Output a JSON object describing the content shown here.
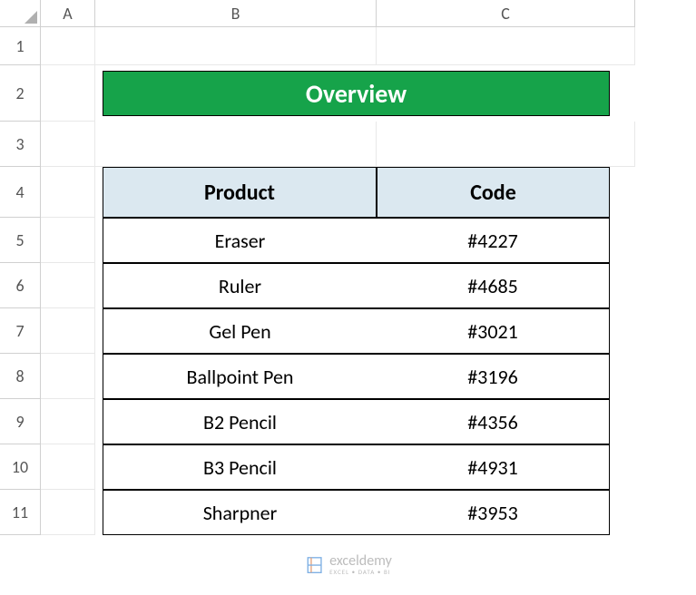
{
  "columns": [
    "A",
    "B",
    "C"
  ],
  "rows": [
    "1",
    "2",
    "3",
    "4",
    "5",
    "6",
    "7",
    "8",
    "9",
    "10",
    "11"
  ],
  "title": "Overview",
  "table": {
    "headers": {
      "product": "Product",
      "code": "Code"
    },
    "data": [
      {
        "product": "Eraser",
        "code": "#4227"
      },
      {
        "product": "Ruler",
        "code": "#4685"
      },
      {
        "product": "Gel Pen",
        "code": "#3021"
      },
      {
        "product": "Ballpoint Pen",
        "code": "#3196"
      },
      {
        "product": "B2 Pencil",
        "code": "#4356"
      },
      {
        "product": "B3 Pencil",
        "code": "#4931"
      },
      {
        "product": "Sharpner",
        "code": "#3953"
      }
    ]
  },
  "watermark": "exceldemy",
  "watermark_sub": "EXCEL • DATA • BI",
  "chart_data": {
    "type": "table",
    "title": "Overview",
    "columns": [
      "Product",
      "Code"
    ],
    "rows": [
      [
        "Eraser",
        "#4227"
      ],
      [
        "Ruler",
        "#4685"
      ],
      [
        "Gel Pen",
        "#3021"
      ],
      [
        "Ballpoint Pen",
        "#3196"
      ],
      [
        "B2 Pencil",
        "#4356"
      ],
      [
        "B3 Pencil",
        "#4931"
      ],
      [
        "Sharpner",
        "#3953"
      ]
    ]
  }
}
